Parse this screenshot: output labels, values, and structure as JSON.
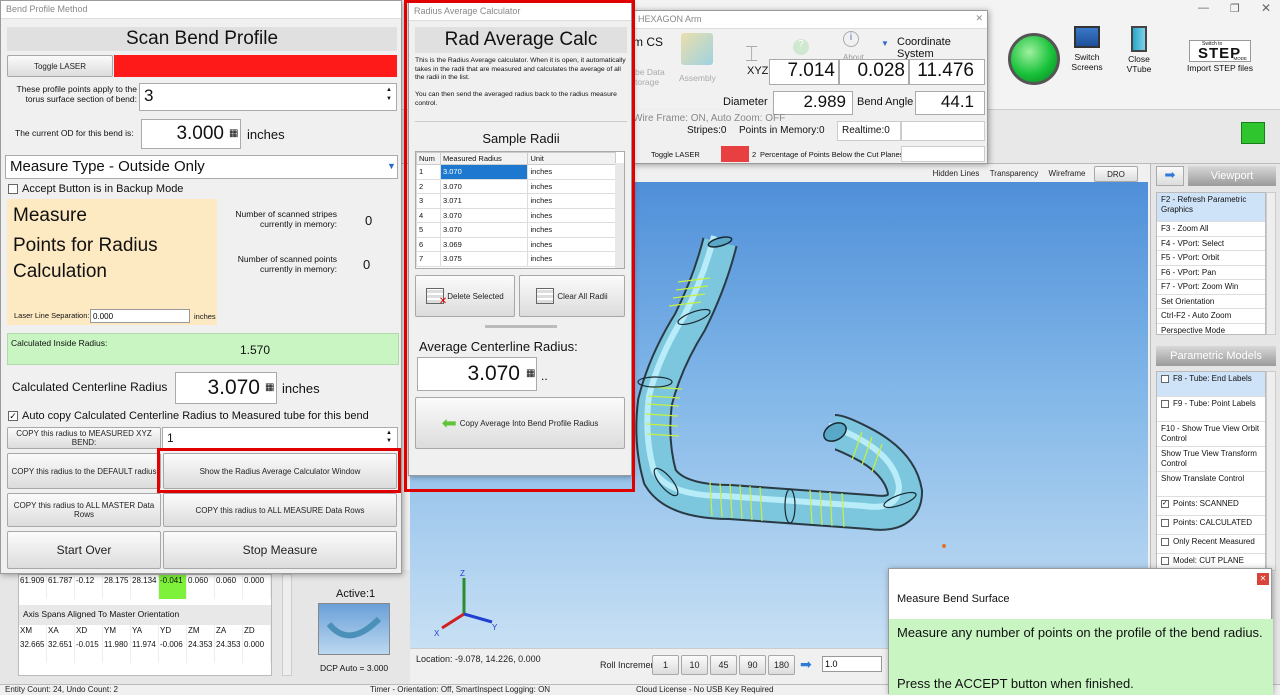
{
  "bend_profile": {
    "window_title": "Bend Profile Method",
    "scan_title": "Scan Bend Profile",
    "toggle_laser": "Toggle LASER",
    "apply_label": "These profile points apply to the torus surface section of bend:",
    "apply_value": "3",
    "od_label": "The current OD for this bend is:",
    "od_value": "3.000",
    "od_unit": "inches",
    "measure_type": "Measure Type - Outside Only",
    "accept_backup": "Accept Button is in Backup Mode",
    "measure_line1": "Measure",
    "measure_line2": "Points for Radius",
    "measure_line3": "Calculation",
    "stripes_label": "Number of scanned stripes currently in memory:",
    "stripes_value": "0",
    "points_label": "Number of scanned points currently in memory:",
    "points_value": "0",
    "laser_sep_label": "Laser Line Separation:",
    "laser_sep_value": "0.000",
    "laser_sep_unit": "inches",
    "calc_inside_label": "Calculated Inside Radius:",
    "calc_inside_value": "1.570",
    "calc_centerline_label": "Calculated Centerline Radius",
    "calc_centerline_value": "3.070",
    "calc_centerline_unit": "inches",
    "auto_copy": "Auto copy Calculated Centerline Radius to Measured tube for this bend",
    "copy_xyz": "COPY this radius to MEASURED XYZ BEND:",
    "copy_xyz_value": "1",
    "copy_default": "COPY this radius to the DEFAULT radius",
    "show_calc": "Show the Radius Average Calculator Window",
    "copy_master": "COPY this radius to ALL MASTER Data Rows",
    "copy_measure": "COPY this radius to ALL MEASURE Data Rows",
    "start_over": "Start Over",
    "stop_measure": "Stop Measure"
  },
  "calc": {
    "window_title": "Radius Average Calculator",
    "title": "Rad Average Calc",
    "desc1": "This is the Radius Average calculator. When it is open, it automatically takes in the radii that are measured and calculates the average of all the radii in the list.",
    "desc2": "You can then send the averaged radius back to the radius measure control.",
    "sample_title": "Sample Radii",
    "col_num": "Num",
    "col_radius": "Measured Radius",
    "col_unit": "Unit",
    "rows": [
      {
        "num": "1",
        "radius": "3.070",
        "unit": "inches"
      },
      {
        "num": "2",
        "radius": "3.070",
        "unit": "inches"
      },
      {
        "num": "3",
        "radius": "3.071",
        "unit": "inches"
      },
      {
        "num": "4",
        "radius": "3.070",
        "unit": "inches"
      },
      {
        "num": "5",
        "radius": "3.070",
        "unit": "inches"
      },
      {
        "num": "6",
        "radius": "3.069",
        "unit": "inches"
      },
      {
        "num": "7",
        "radius": "3.075",
        "unit": "inches"
      }
    ],
    "delete_selected": "Delete Selected",
    "clear_all": "Clear All Radii",
    "avg_label": "Average Centerline Radius:",
    "avg_value": "3.070",
    "avg_suffix": "..",
    "copy_avg": "Copy Average Into Bend Profile Radius"
  },
  "arm": {
    "window_title": "HEXAGON Arm",
    "cs_label": "rm CS",
    "store_label": "be Data\ntorage",
    "assembly_label": "Assembly",
    "about_label": "About",
    "coord_system": "Coordinate System",
    "xyz_label": "XYZ",
    "x": "7.014",
    "y": "0.028",
    "z": "11.476",
    "diameter_label": "Diameter",
    "diameter_value": "2.989",
    "bend_angle_label": "Bend Angle",
    "bend_angle_value": "44.1",
    "wireframe_info": "Wire Frame: ON, Auto Zoom: OFF",
    "stripes": "Stripes:0",
    "points_in_memory": "Points in Memory:0",
    "realtime": "Realtime:0",
    "toggle_laser": "Toggle LASER",
    "pct_num": "2",
    "pct_label": "Percentage of Points Below the Cut Planes"
  },
  "toolbar": {
    "switch_screens": "Switch Screens",
    "close_vtube": "Close VTube",
    "step_small": "Switch to",
    "step_big": "STEP",
    "step_mode": "MODE",
    "import_step": "Import STEP files"
  },
  "view_buttons": {
    "hidden": "Hidden Lines",
    "transparency": "Transparency",
    "wireframe": "Wireframe",
    "dro": "DRO"
  },
  "viewport": {
    "title": "Viewport",
    "items": [
      "F2 - Refresh Parametric Graphics",
      "F3 - Zoom All",
      "F4 - VPort: Select",
      "F5 - VPort: Orbit",
      "F6 - VPort: Pan",
      "F7 - VPort: Zoom Win",
      "Set Orientation",
      "Ctrl-F2 - Auto Zoom",
      "Perspective Mode"
    ]
  },
  "parametric": {
    "title": "Parametric Models",
    "items": [
      {
        "label": "F8 - Tube: End Labels",
        "cb": true,
        "checked": false
      },
      {
        "label": "F9 - Tube: Point Labels",
        "cb": true,
        "checked": false
      },
      {
        "label": "F10 - Show True View Orbit Control",
        "cb": false,
        "checked": false
      },
      {
        "label": "Show True View Transform Control",
        "cb": false,
        "checked": false
      },
      {
        "label": "Show Translate Control",
        "cb": false,
        "checked": false
      },
      {
        "label": "Points: SCANNED",
        "cb": true,
        "checked": true
      },
      {
        "label": "Points: CALCULATED",
        "cb": true,
        "checked": false
      },
      {
        "label": "Only Recent Measured",
        "cb": true,
        "checked": false
      },
      {
        "label": "Model: CUT PLANE",
        "cb": true,
        "checked": false
      }
    ]
  },
  "bottom_grid": {
    "row1": [
      "61.909",
      "61.787",
      "-0.12",
      "28.175",
      "28.134",
      "-0.041",
      "0.060",
      "0.060",
      "0.000"
    ],
    "spans_title": "Axis Spans Aligned To Master Orientation",
    "headers": [
      "XM",
      "XA",
      "XD",
      "YM",
      "YA",
      "YD",
      "ZM",
      "ZA",
      "ZD"
    ],
    "row2": [
      "32.665",
      "32.651",
      "-0.015",
      "11.980",
      "11.974",
      "-0.006",
      "24.353",
      "24.353",
      "0.000"
    ],
    "active": "Active:1",
    "dcp": "DCP Auto = 3.000"
  },
  "bottombar": {
    "location": "Location: -9.078, 14.226, 0.000",
    "roll_increment": "Roll Increment",
    "rolls": [
      "1",
      "10",
      "45",
      "90",
      "180"
    ],
    "roll_value": "1.0"
  },
  "statusbar": {
    "entity": "Entity Count: 24, Undo Count: 2",
    "timer": "Timer - Orientation: Off, SmartInspect Logging: ON",
    "cloud": "Cloud License - No USB Key Required"
  },
  "popup": {
    "title": "Measure Bend Surface",
    "line1": "Measure any number of points on the profile of the bend radius.",
    "line2": "Press the ACCEPT button when finished."
  },
  "colors": {
    "accent_red": "#ff1a1a",
    "green_fill": "#c8f5c2",
    "yellow_panel": "#fde9c2",
    "viewport_bg": "#a9cff0",
    "tube": "#7cc7de"
  }
}
